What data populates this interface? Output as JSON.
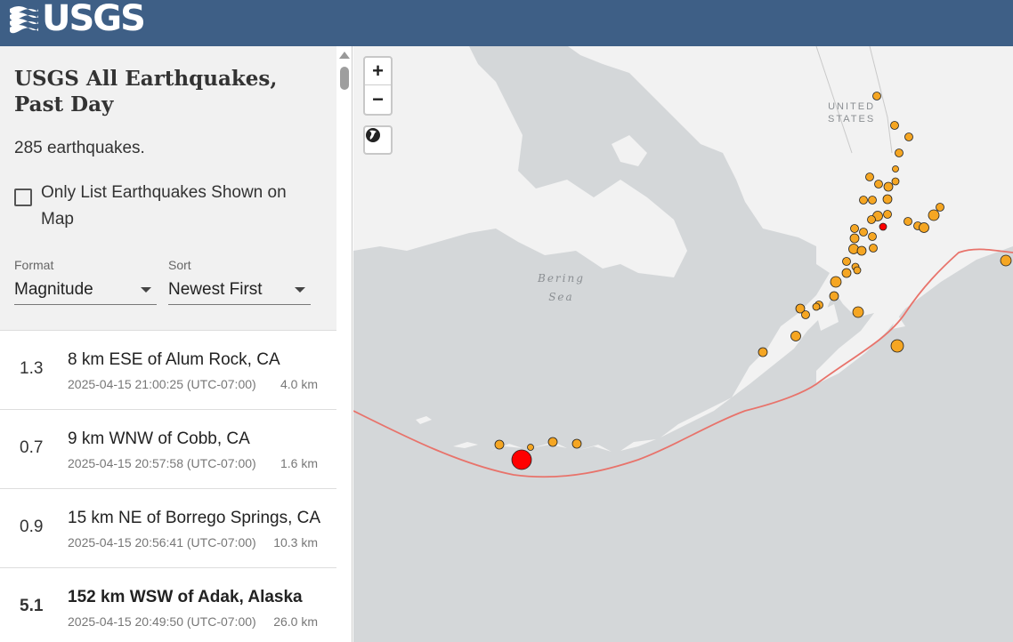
{
  "header": {
    "logo_text": "USGS",
    "logo_icon": "usgs-wave-icon",
    "color": "#3e5f86"
  },
  "sidebar": {
    "title": "USGS All Earthquakes, Past Day",
    "count_text": "285 earthquakes.",
    "only_list_label": "Only List Earthquakes Shown on Map",
    "format": {
      "caption": "Format",
      "value": "Magnitude"
    },
    "sort": {
      "caption": "Sort",
      "value": "Newest First"
    }
  },
  "earthquakes": [
    {
      "mag": "1.3",
      "place": "8 km ESE of Alum Rock, CA",
      "time": "2025-04-15 21:00:25 (UTC-07:00)",
      "depth": "4.0 km"
    },
    {
      "mag": "0.7",
      "place": "9 km WNW of Cobb, CA",
      "time": "2025-04-15 20:57:58 (UTC-07:00)",
      "depth": "1.6 km"
    },
    {
      "mag": "0.9",
      "place": "15 km NE of Borrego Springs, CA",
      "time": "2025-04-15 20:56:41 (UTC-07:00)",
      "depth": "10.3 km"
    },
    {
      "mag": "5.1",
      "place": "152 km WSW of Adak, Alaska",
      "time": "2025-04-15 20:49:50 (UTC-07:00)",
      "depth": "26.0 km"
    }
  ],
  "map": {
    "zoom_in": "+",
    "zoom_out": "−",
    "country_label_1": "UNITED",
    "country_label_2": "STATES",
    "sea_label_1": "Bering",
    "sea_label_2": "Sea",
    "colors": {
      "water": "#d4d7d9",
      "land": "#f2f2f2",
      "marker": "#f5a623",
      "marker_recent": "#ff0000",
      "plate_boundary": "#e8736b"
    }
  }
}
